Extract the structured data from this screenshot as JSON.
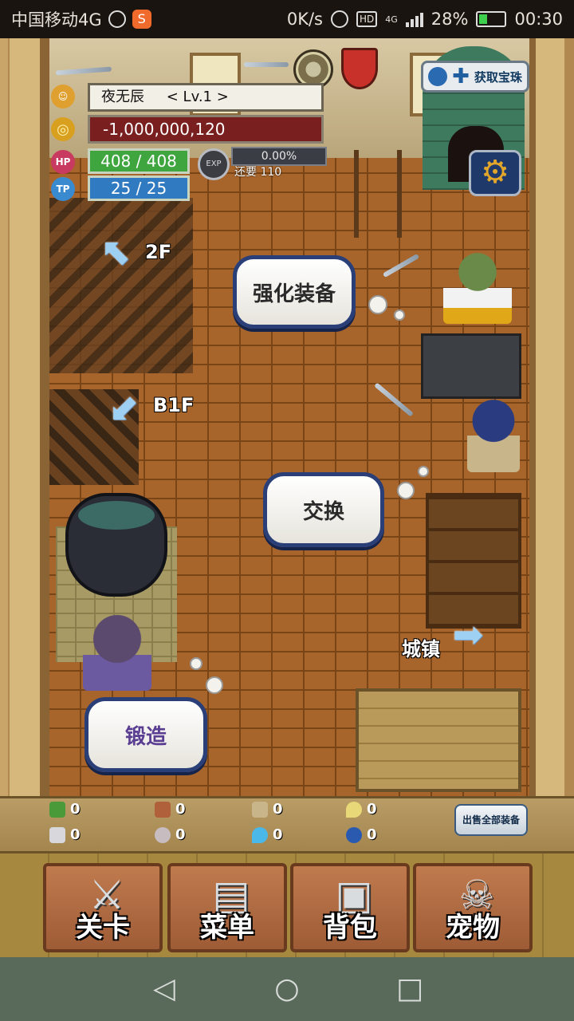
{
  "status_bar": {
    "carrier": "中国移动4G",
    "net_speed": "0K/s",
    "hd_badge": "HD",
    "network_type": "4G",
    "battery": "28%",
    "time": "00:30"
  },
  "player": {
    "name": "夜无辰",
    "level": "< Lv.1 >",
    "gold": "-1,000,000,120",
    "hp_label": "HP",
    "hp": "408 / 408",
    "tp_label": "TP",
    "tp": "25 / 25",
    "exp_label": "EXP",
    "exp_percent": "0.00%",
    "exp_needed": "还要 110"
  },
  "gain_treasure": {
    "label": "获取宝珠"
  },
  "floor_nav": {
    "up_label": "2F",
    "down_label": "B1F",
    "town_label": "城镇"
  },
  "bubbles": {
    "enhance": "强化装备",
    "exchange": "交换",
    "forge": "锻造"
  },
  "resources": [
    {
      "icon": "herb-icon",
      "value": "0",
      "color": "#4a9a3a"
    },
    {
      "icon": "wood-icon",
      "value": "0",
      "color": "#b0603a"
    },
    {
      "icon": "branch-icon",
      "value": "0",
      "color": "#c9b58a"
    },
    {
      "icon": "flame-icon",
      "value": "0",
      "color": "#e8d878"
    },
    {
      "icon": "iron-bar-icon",
      "value": "0",
      "color": "#d8d8dc"
    },
    {
      "icon": "ore-icon",
      "value": "0",
      "color": "#c7bcc0"
    },
    {
      "icon": "blue-flame-icon",
      "value": "0",
      "color": "#4ab8e8"
    },
    {
      "icon": "orb-icon",
      "value": "0",
      "color": "#2a5ab0"
    }
  ],
  "sell_all": "出售全部装备",
  "menu": [
    {
      "label": "关卡",
      "icon": "crossed-swords-icon"
    },
    {
      "label": "菜单",
      "icon": "book-icon"
    },
    {
      "label": "背包",
      "icon": "backpack-icon"
    },
    {
      "label": "宠物",
      "icon": "dragon-skull-icon"
    }
  ],
  "colors": {
    "gold_box": "#7a1f1f",
    "hp_bar": "#3fa53e",
    "tp_bar": "#2f7ac0",
    "bubble_border": "#2a3f78"
  }
}
